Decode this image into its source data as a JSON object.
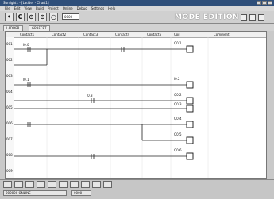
{
  "window": {
    "title": "Sunlight1 - [Ladder - Chart1]"
  },
  "menu": [
    "File",
    "Edit",
    "View",
    "Build",
    "Project",
    "Online",
    "Debug",
    "Settings",
    "Help"
  ],
  "toolbar": {
    "input_value": "0000",
    "mode_label": "MODE EDITION"
  },
  "tabs": [
    "LADDER",
    "GRAFCET"
  ],
  "columns": [
    "Contact1",
    "Contact2",
    "Contact3",
    "Contact4",
    "Contact5",
    "Coil",
    "Comment"
  ],
  "line_numbers": [
    "001",
    "002",
    "003",
    "004",
    "005",
    "006",
    "007",
    "008",
    "009"
  ],
  "rung_labels": [
    "Q0.1",
    "I0.2",
    "Q0.2",
    "Q0.3",
    "Q0.4",
    "Q0.5",
    "Q0.6"
  ],
  "contact_labels": [
    "I0.0",
    "I0.1",
    "I0.3"
  ],
  "status": {
    "field1": "000000 ONLINE",
    "field2": "0000"
  }
}
